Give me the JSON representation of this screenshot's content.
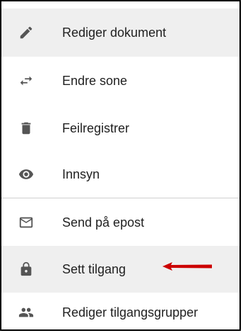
{
  "menu": {
    "items": [
      {
        "label": "Rediger dokument",
        "icon": "pencil-icon"
      },
      {
        "label": "Endre sone",
        "icon": "swap-arrows-icon"
      },
      {
        "label": "Feilregistrer",
        "icon": "trash-icon"
      },
      {
        "label": "Innsyn",
        "icon": "eye-icon"
      },
      {
        "label": "Send på epost",
        "icon": "envelope-icon"
      },
      {
        "label": "Sett tilgang",
        "icon": "lock-icon"
      },
      {
        "label": "Rediger tilgangsgrupper",
        "icon": "people-icon"
      }
    ]
  },
  "colors": {
    "icon": "#555555",
    "hover_background": "#efefef",
    "annotation_arrow": "#cc0000"
  }
}
